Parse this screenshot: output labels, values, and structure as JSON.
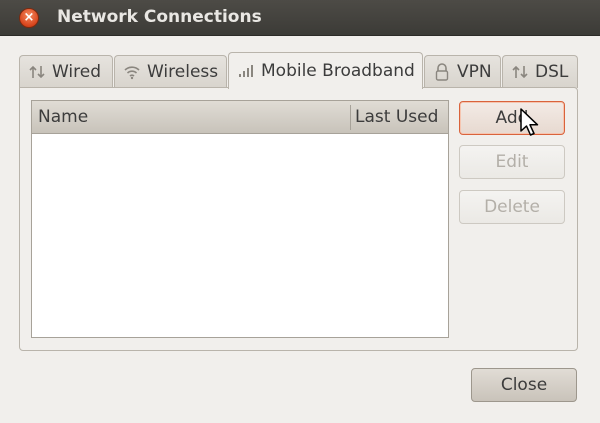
{
  "window": {
    "title": "Network Connections",
    "close_glyph": "×"
  },
  "tabs": [
    {
      "label": "Wired",
      "icon": "wired-icon"
    },
    {
      "label": "Wireless",
      "icon": "wireless-icon"
    },
    {
      "label": "Mobile Broadband",
      "icon": "mobile-broadband-icon",
      "active": true
    },
    {
      "label": "VPN",
      "icon": "lock-icon"
    },
    {
      "label": "DSL",
      "icon": "dsl-icon"
    }
  ],
  "list": {
    "columns": [
      "Name",
      "Last Used"
    ],
    "rows": []
  },
  "buttons": {
    "add": "Add",
    "edit": "Edit",
    "delete": "Delete",
    "close": "Close"
  },
  "colors": {
    "titlebar": "#3c3b37",
    "close_button": "#d8451d",
    "add_button_border": "#d9633c"
  }
}
